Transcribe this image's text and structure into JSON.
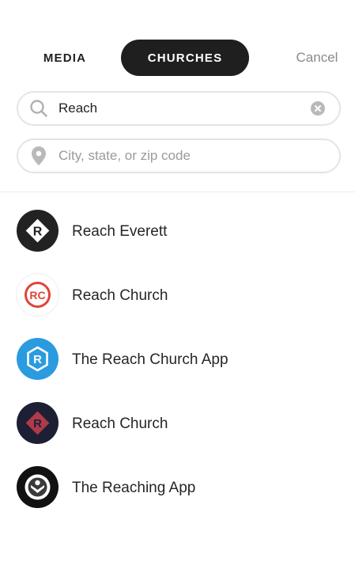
{
  "tabs": {
    "media_label": "MEDIA",
    "churches_label": "CHURCHES",
    "cancel_label": "Cancel"
  },
  "search": {
    "value": "Reach",
    "icon": "search-icon",
    "clear_icon": "clear-icon"
  },
  "location": {
    "placeholder": "City, state, or zip code",
    "icon": "location-pin-icon"
  },
  "results": [
    {
      "label": "Reach Everett",
      "logo": "reach-everett-logo"
    },
    {
      "label": "Reach Church",
      "logo": "reach-church-rc-logo"
    },
    {
      "label": "The Reach Church App",
      "logo": "reach-church-app-logo"
    },
    {
      "label": "Reach Church",
      "logo": "reach-church-diamond-logo"
    },
    {
      "label": "The Reaching App",
      "logo": "reaching-app-logo"
    }
  ],
  "colors": {
    "active_tab_bg": "#1f1f1f",
    "field_border": "#e4e4e4",
    "muted_text": "#8a8a8a"
  }
}
